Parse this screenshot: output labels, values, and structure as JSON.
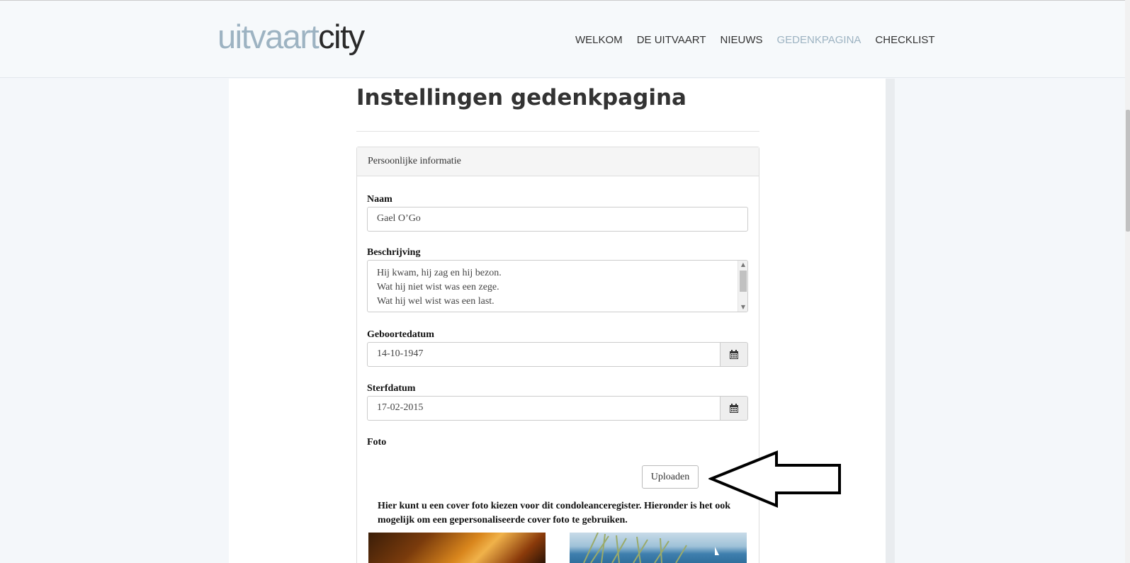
{
  "header": {
    "logo_part1": "uitvaart",
    "logo_part2": "city",
    "nav": [
      "WELKOM",
      "DE UITVAART",
      "NIEUWS",
      "GEDENKPAGINA",
      "CHECKLIST"
    ],
    "active_nav": "GEDENKPAGINA",
    "accent_color": "#9db3c2"
  },
  "page": {
    "title": "Instellingen gedenkpagina"
  },
  "card": {
    "heading": "Persoonlijke informatie",
    "name_label": "Naam",
    "name_value": "Gael O’Go",
    "description_label": "Beschrijving",
    "description_lines": [
      "Hij kwam, hij zag en hij bezon.",
      "Wat hij niet wist was een zege.",
      "Wat hij wel wist was een last."
    ],
    "birth_label": "Geboortedatum",
    "birth_value": "14-10-1947",
    "death_label": "Sterfdatum",
    "death_value": "17-02-2015",
    "photo_label": "Foto",
    "upload_label": "Uploaden",
    "help_text": "Hier kunt u een cover foto kiezen voor dit condoleanceregister. Hieronder is het ook mogelijk om een gepersonaliseerde cover foto te gebruiken."
  },
  "icons": {
    "calendar": "calendar-icon",
    "annotation": "arrow-left-icon"
  }
}
